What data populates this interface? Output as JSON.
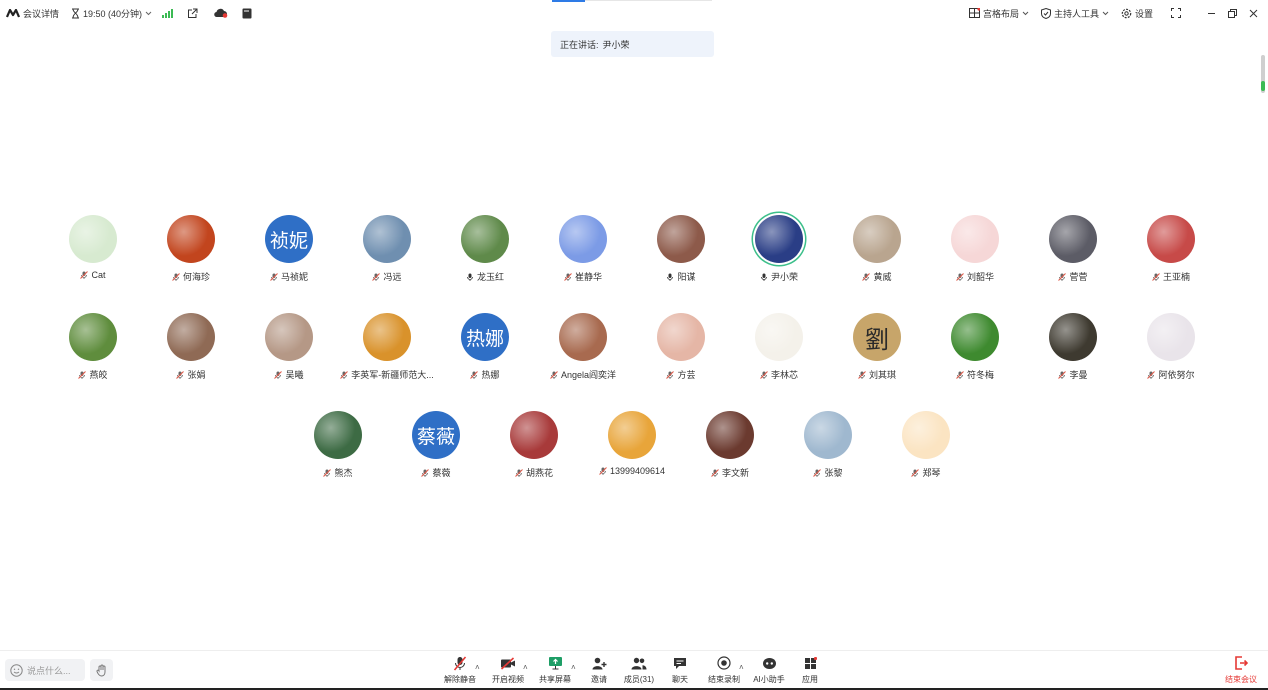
{
  "top_left": {
    "meeting_info_label": "会议详情",
    "timer_text": "19:50 (40分钟)"
  },
  "top_right": {
    "layout_label": "宫格布局",
    "host_tools_label": "主持人工具",
    "settings_label": "设置"
  },
  "speaking": {
    "label": "正在讲话:",
    "name": "尹小荣"
  },
  "participants": [
    {
      "name": "Cat",
      "mic": "muted",
      "bg": "#d7ead0",
      "initials": ""
    },
    {
      "name": "何海珍",
      "mic": "muted",
      "bg": "#c2451e",
      "initials": ""
    },
    {
      "name": "马祯妮",
      "mic": "muted",
      "bg": "#2f6fc6",
      "initials": "祯妮"
    },
    {
      "name": "冯远",
      "mic": "muted",
      "bg": "#6f8fb0",
      "initials": ""
    },
    {
      "name": "龙玉红",
      "mic": "on",
      "bg": "#5f8a4a",
      "initials": ""
    },
    {
      "name": "崔静华",
      "mic": "muted",
      "bg": "#7c9be6",
      "initials": ""
    },
    {
      "name": "阳谋",
      "mic": "on",
      "bg": "#8d5a4a",
      "initials": ""
    },
    {
      "name": "尹小荣",
      "mic": "on",
      "bg": "#2a3e86",
      "initials": "",
      "speaking": true
    },
    {
      "name": "黄威",
      "mic": "muted",
      "bg": "#b9a58f",
      "initials": ""
    },
    {
      "name": "刘韶华",
      "mic": "muted",
      "bg": "#f6d7d7",
      "initials": ""
    },
    {
      "name": "菅菅",
      "mic": "muted",
      "bg": "#5c5c66",
      "initials": ""
    },
    {
      "name": "王亚楠",
      "mic": "muted",
      "bg": "#c74a48",
      "initials": ""
    },
    {
      "name": "燕皎",
      "mic": "muted",
      "bg": "#5f8d3d",
      "initials": ""
    },
    {
      "name": "张娟",
      "mic": "muted",
      "bg": "#8f6a55",
      "initials": ""
    },
    {
      "name": "吴曦",
      "mic": "muted",
      "bg": "#b59886",
      "initials": ""
    },
    {
      "name": "李英军-新疆师范大...",
      "mic": "muted",
      "bg": "#d9922b",
      "initials": ""
    },
    {
      "name": "热娜",
      "mic": "muted",
      "bg": "#2f6fc6",
      "initials": "热娜"
    },
    {
      "name": "Angela阎奕洋",
      "mic": "muted",
      "bg": "#a86a4f",
      "initials": ""
    },
    {
      "name": "方芸",
      "mic": "muted",
      "bg": "#e5b6a6",
      "initials": ""
    },
    {
      "name": "李林芯",
      "mic": "muted",
      "bg": "#f4f1ea",
      "initials": ""
    },
    {
      "name": "刘其琪",
      "mic": "muted",
      "bg": "#c7a56a",
      "initials": "劉"
    },
    {
      "name": "符冬梅",
      "mic": "muted",
      "bg": "#3e8a2f",
      "initials": ""
    },
    {
      "name": "李曼",
      "mic": "muted",
      "bg": "#3e3a30",
      "initials": ""
    },
    {
      "name": "阿依努尔",
      "mic": "muted",
      "bg": "#e9e4ea",
      "initials": ""
    },
    {
      "name": "熊杰",
      "mic": "muted",
      "bg": "#3d6b44",
      "initials": ""
    },
    {
      "name": "蔡薇",
      "mic": "muted",
      "bg": "#2f6fc6",
      "initials": "蔡薇"
    },
    {
      "name": "胡燕花",
      "mic": "muted",
      "bg": "#a83a3a",
      "initials": ""
    },
    {
      "name": "13999409614",
      "mic": "muted",
      "bg": "#e8a53a",
      "initials": ""
    },
    {
      "name": "李文新",
      "mic": "muted",
      "bg": "#6b3a2f",
      "initials": ""
    },
    {
      "name": "张黎",
      "mic": "muted",
      "bg": "#9fb8cf",
      "initials": ""
    },
    {
      "name": "郑琴",
      "mic": "muted",
      "bg": "#fbe4c2",
      "initials": ""
    }
  ],
  "bottom": {
    "chat_placeholder": "说点什么...",
    "tools": {
      "unmute": "解除静音",
      "video": "开启视频",
      "share": "共享屏幕",
      "invite": "邀请",
      "members": "成员(31)",
      "chat": "聊天",
      "end_recording": "结束录制",
      "ai_assistant": "AI小助手",
      "apps": "应用"
    },
    "end_meeting": "结束会议"
  },
  "colors": {
    "accent_blue": "#2e7be6",
    "speaking_ring": "#3cbf8a",
    "end_red": "#e53935",
    "muted_mic": "#e05a4a"
  }
}
